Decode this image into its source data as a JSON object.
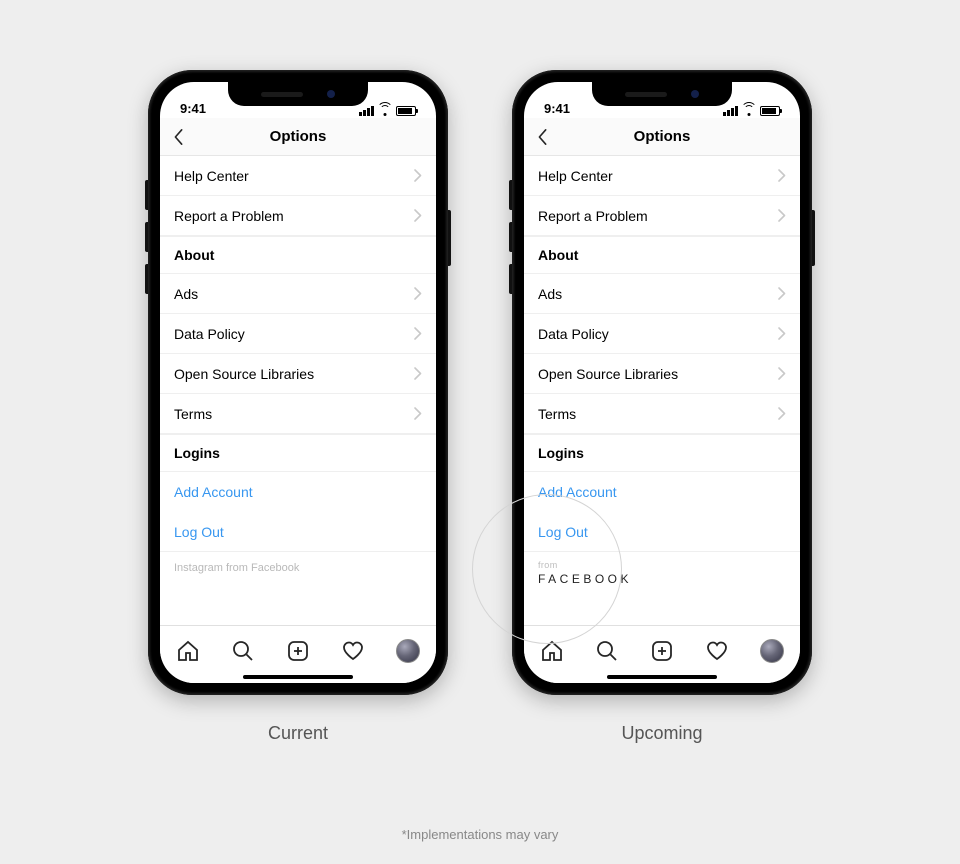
{
  "status_time": "9:41",
  "header_title": "Options",
  "sections": {
    "help": {
      "items": [
        "Help Center",
        "Report a Problem"
      ]
    },
    "about": {
      "title": "About",
      "items": [
        "Ads",
        "Data Policy",
        "Open Source Libraries",
        "Terms"
      ]
    },
    "logins": {
      "title": "Logins",
      "items": [
        "Add Account",
        "Log Out"
      ]
    }
  },
  "footer_current": "Instagram from Facebook",
  "footer_upcoming_from": "from",
  "footer_upcoming_brand": "FACEBOOK",
  "captions": {
    "current": "Current",
    "upcoming": "Upcoming"
  },
  "footnote": "*Implementations may vary"
}
